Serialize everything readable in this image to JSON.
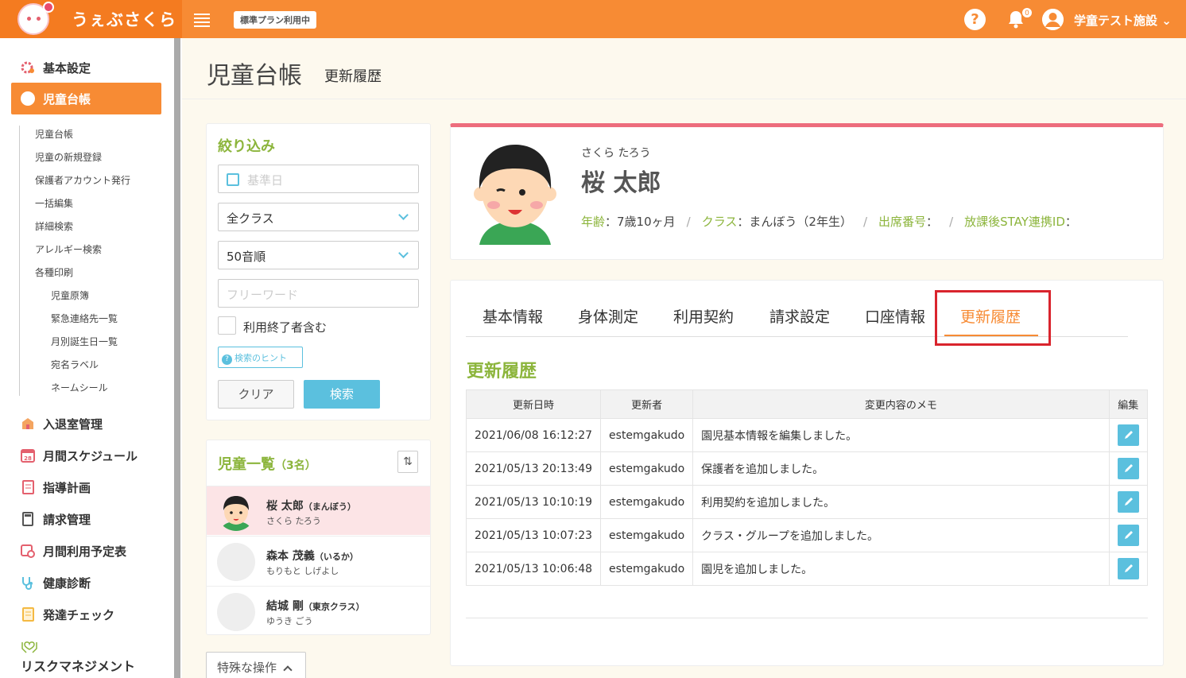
{
  "header": {
    "logo_text": "うぇぶさくら",
    "plan_badge": "標準プラン利用中",
    "help_glyph": "?",
    "notification_count": "0",
    "user_name": "学童テスト施設"
  },
  "sidebar": {
    "main_items": [
      {
        "label": "基本設定",
        "icon": "gear-icon"
      },
      {
        "label": "児童台帳",
        "icon": "child-face-icon"
      },
      {
        "label": "入退室管理",
        "icon": "school-icon"
      },
      {
        "label": "月間スケジュール",
        "icon": "calendar-icon",
        "icon_text": "28"
      },
      {
        "label": "指導計画",
        "icon": "notebook-icon"
      },
      {
        "label": "請求管理",
        "icon": "calculator-icon"
      },
      {
        "label": "月間利用予定表",
        "icon": "calendar-clock-icon"
      },
      {
        "label": "健康診断",
        "icon": "stethoscope-icon"
      },
      {
        "label": "発達チェック",
        "icon": "checklist-icon"
      },
      {
        "label": "リスクマネジメント",
        "icon": "hands-heart-icon"
      }
    ],
    "sub_items": [
      "児童台帳",
      "児童の新規登録",
      "保護者アカウント発行",
      "一括編集",
      "詳細検索",
      "アレルギー検索",
      "各種印刷"
    ],
    "print_items": [
      "児童原簿",
      "緊急連絡先一覧",
      "月別誕生日一覧",
      "宛名ラベル",
      "ネームシール"
    ]
  },
  "page": {
    "title": "児童台帳",
    "subtitle": "更新履歴"
  },
  "filter": {
    "title": "絞り込み",
    "date_placeholder": "基準日",
    "class_select": "全クラス",
    "order_select": "50音順",
    "freeword_placeholder": "フリーワード",
    "include_ended_label": "利用終了者含む",
    "hint_button": "検索のヒント",
    "clear_button": "クリア",
    "search_button": "検索"
  },
  "children": {
    "title": "児童一覧",
    "count": "（3名）",
    "sort_glyph": "⇅",
    "items": [
      {
        "name": "桜 太郎",
        "class": "（まんぼう）",
        "kana": "さくら たろう"
      },
      {
        "name": "森本 茂義",
        "class": "（いるか）",
        "kana": "もりもと しげよし"
      },
      {
        "name": "結城 剛",
        "class": "（東京クラス）",
        "kana": "ゆうき ごう"
      }
    ],
    "special_button": "特殊な操作"
  },
  "profile": {
    "kana": "さくら たろう",
    "name": "桜 太郎",
    "age_label": "年齢",
    "age_value": "：7歳10ヶ月",
    "class_label": "クラス",
    "class_value": "：まんぼう（2年生）",
    "attendance_label": "出席番号",
    "attendance_value": "：",
    "stay_label": "放課後STAY連携ID",
    "stay_value": "：",
    "separator": "/"
  },
  "tabs": [
    "基本情報",
    "身体測定",
    "利用契約",
    "請求設定",
    "口座情報",
    "更新履歴"
  ],
  "history": {
    "title": "更新履歴",
    "columns": [
      "更新日時",
      "更新者",
      "変更内容のメモ",
      "編集"
    ],
    "rows": [
      [
        "2021/06/08 16:12:27",
        "estemgakudo",
        "園児基本情報を編集しました。"
      ],
      [
        "2021/05/13 20:13:49",
        "estemgakudo",
        "保護者を追加しました。"
      ],
      [
        "2021/05/13 10:10:19",
        "estemgakudo",
        "利用契約を追加しました。"
      ],
      [
        "2021/05/13 10:07:23",
        "estemgakudo",
        "クラス・グループを追加しました。"
      ],
      [
        "2021/05/13 10:06:48",
        "estemgakudo",
        "園児を追加しました。"
      ]
    ]
  },
  "colors": {
    "header_orange": "#f78b34",
    "accent_green": "#8cb53c",
    "accent_blue": "#5bc0de",
    "accent_pink": "#ed6d7d",
    "highlight_red": "#d9242d"
  }
}
